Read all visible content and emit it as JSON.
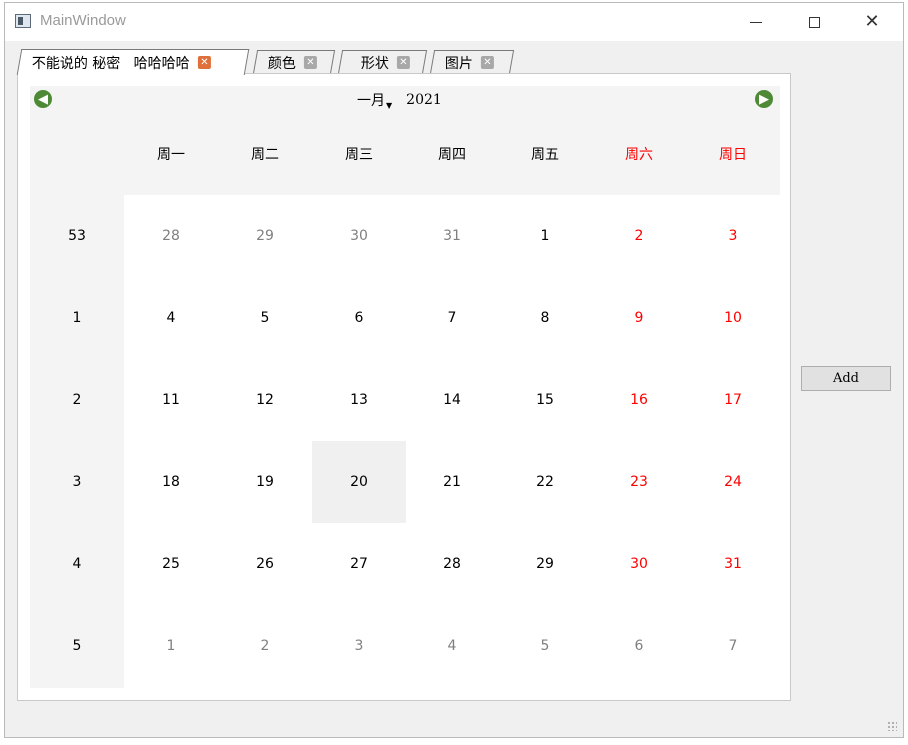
{
  "window": {
    "title": "MainWindow",
    "controls": {
      "minimize": "minimize-icon",
      "maximize": "maximize-icon",
      "close": "close-icon"
    }
  },
  "tabs": [
    {
      "label": "不能说的 秘密   哈哈哈哈",
      "active": true
    },
    {
      "label": "颜色",
      "active": false
    },
    {
      "label": "形状",
      "active": false
    },
    {
      "label": "图片",
      "active": false
    }
  ],
  "calendar": {
    "month": "一月",
    "year": "2021",
    "prev_icon": "arrow-left-icon",
    "next_icon": "arrow-right-icon",
    "weekdays": [
      "周一",
      "周二",
      "周三",
      "周四",
      "周五",
      "周六",
      "周日"
    ],
    "weeks": [
      {
        "week": "53",
        "days": [
          "28",
          "29",
          "30",
          "31",
          "1",
          "2",
          "3"
        ]
      },
      {
        "week": "1",
        "days": [
          "4",
          "5",
          "6",
          "7",
          "8",
          "9",
          "10"
        ]
      },
      {
        "week": "2",
        "days": [
          "11",
          "12",
          "13",
          "14",
          "15",
          "16",
          "17"
        ]
      },
      {
        "week": "3",
        "days": [
          "18",
          "19",
          "20",
          "21",
          "22",
          "23",
          "24"
        ]
      },
      {
        "week": "4",
        "days": [
          "25",
          "26",
          "27",
          "28",
          "29",
          "30",
          "31"
        ]
      },
      {
        "week": "5",
        "days": [
          "1",
          "2",
          "3",
          "4",
          "5",
          "6",
          "7"
        ]
      }
    ],
    "selected_day": "20",
    "colors": {
      "weekend": "#ff0000",
      "other_month": "#808080",
      "nav_button": "#4e8a36"
    }
  },
  "add_button": {
    "label": "Add"
  }
}
